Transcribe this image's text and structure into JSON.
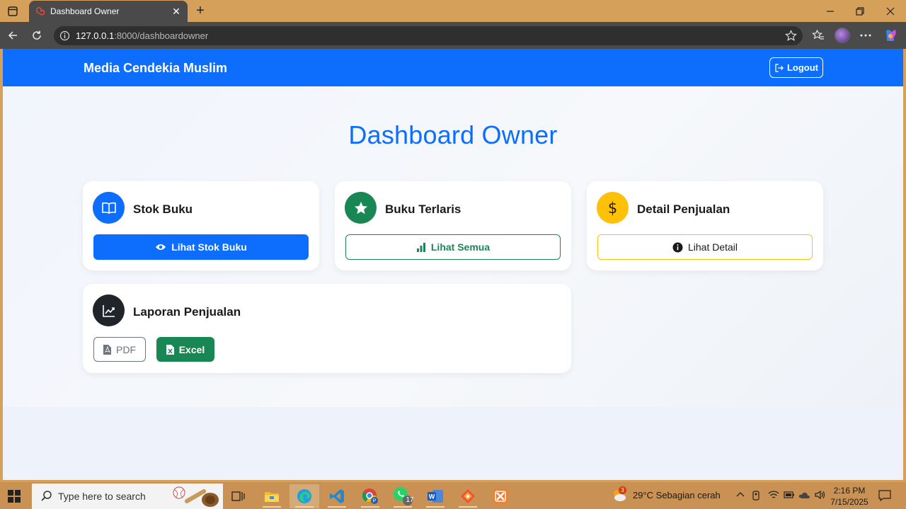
{
  "browser": {
    "tab_title": "Dashboard Owner",
    "url_host": "127.0.0.1",
    "url_path": ":8000/dashboardowner"
  },
  "navbar": {
    "brand": "Media Cendekia Muslim",
    "logout_label": "Logout"
  },
  "page": {
    "title": "Dashboard Owner"
  },
  "cards": {
    "stok": {
      "title": "Stok Buku",
      "button": "Lihat Stok Buku",
      "color": "#0d6efd"
    },
    "terlaris": {
      "title": "Buku Terlaris",
      "button": "Lihat Semua",
      "color": "#198754"
    },
    "penjualan": {
      "title": "Detail Penjualan",
      "button": "Lihat Detail",
      "color": "#ffc107"
    },
    "laporan": {
      "title": "Laporan Penjualan",
      "pdf_label": "PDF",
      "excel_label": "Excel",
      "color": "#212529"
    }
  },
  "taskbar": {
    "search_placeholder": "Type here to search",
    "weather": "29°C  Sebagian cerah",
    "weather_badge": "3",
    "whatsapp_badge": "17",
    "time": "2:16 PM",
    "date": "7/15/2025"
  }
}
